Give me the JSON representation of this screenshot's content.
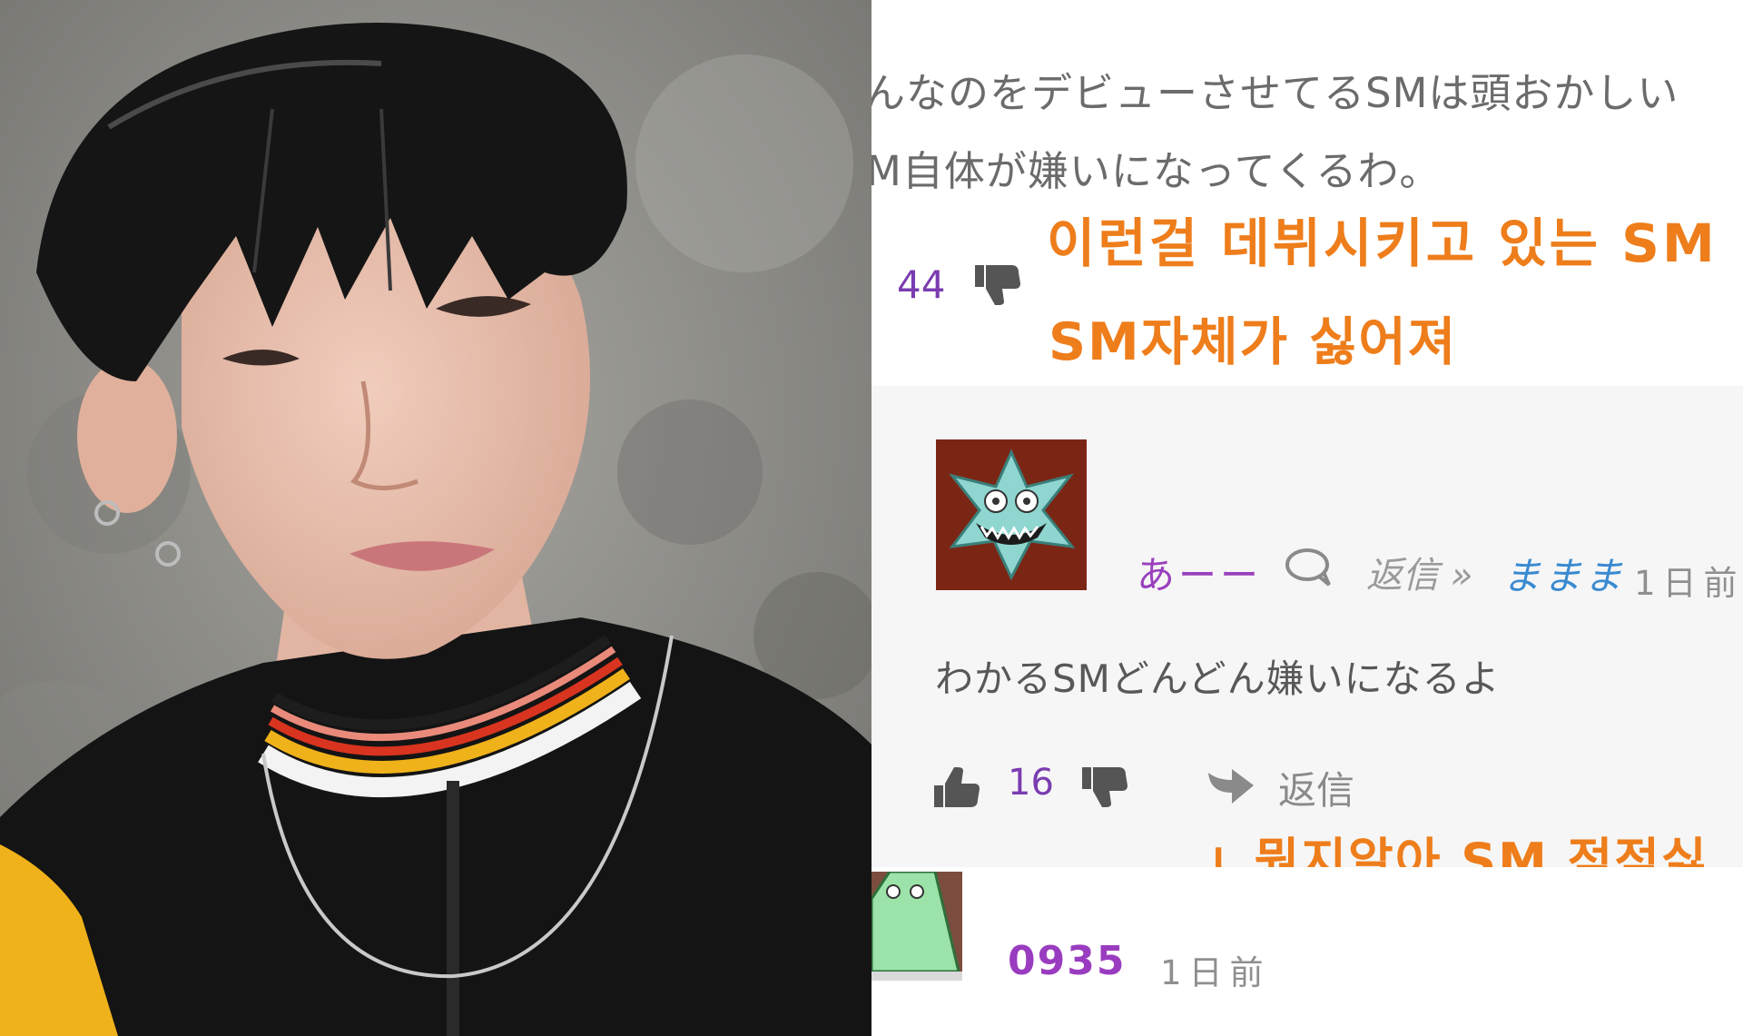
{
  "comment_top": {
    "jp_line1": "んなのをデビューさせてるSMは頭おかしい",
    "jp_line2": "M自体が嫌いになってくるわ。",
    "kr_line1": "이런걸 데뷔시키고 있는 SM",
    "kr_line2": "SM자체가 싫어져",
    "dislike_count": "44"
  },
  "reply": {
    "username": "あーー",
    "reply_link": "返信 »",
    "reply_to": "ままま",
    "time": "1日前",
    "body": "わかるSMどんどん嫌いになるよ",
    "kr_translation": "ㄴ뭔지알아 SM 점점싫",
    "like_count": "16",
    "reply_label": "返信"
  },
  "comment_bottom": {
    "username": "0935",
    "time": "1日前"
  },
  "colors": {
    "translation": "#ee7d1b",
    "username": "#9a40bd",
    "reply_to": "#3a8ad0",
    "count": "#7a3cb0"
  },
  "icons": [
    "dislike-icon",
    "chat-bubble-icon",
    "like-icon",
    "reply-arrow-icon",
    "avatar-star-icon",
    "avatar-green-icon"
  ]
}
